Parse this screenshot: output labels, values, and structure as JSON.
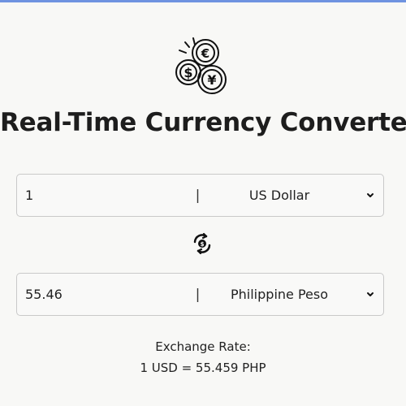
{
  "app": {
    "title": "Real-Time Currency Converter",
    "logo_icon": "coins-euro-dollar-yen-icon"
  },
  "converter": {
    "from": {
      "amount": "1",
      "currency": "US Dollar"
    },
    "to": {
      "amount": "55.46",
      "currency": "Philippine Peso"
    },
    "separator": "|",
    "swap_icon": "swap-currency-icon",
    "exchange_rate_label": "Exchange Rate:",
    "exchange_rate_value": "1 USD = 55.459 PHP"
  },
  "colors": {
    "accent_top_border": "#6f93e0",
    "text": "#1d1d1d",
    "field_border": "#c9c9c9",
    "background": "#f8f8f6"
  }
}
